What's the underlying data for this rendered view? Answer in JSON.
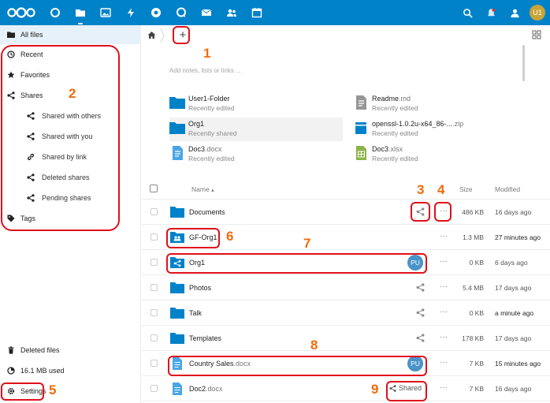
{
  "header": {
    "app_icons": [
      "dashboard-icon",
      "files-icon",
      "photos-icon",
      "activity-icon",
      "talk-icon",
      "circles-icon",
      "mail-icon",
      "contacts-icon",
      "calendar-icon"
    ],
    "avatar_initials": "U1",
    "accent_color": "#0082c9"
  },
  "sidebar": {
    "items": [
      {
        "label": "All files",
        "icon": "folder-icon"
      },
      {
        "label": "Recent",
        "icon": "clock-icon"
      },
      {
        "label": "Favorites",
        "icon": "star-icon"
      },
      {
        "label": "Shares",
        "icon": "share-icon"
      },
      {
        "label": "Shared with others",
        "icon": "share-icon"
      },
      {
        "label": "Shared with you",
        "icon": "share-icon"
      },
      {
        "label": "Shared by link",
        "icon": "link-icon"
      },
      {
        "label": "Deleted shares",
        "icon": "share-icon"
      },
      {
        "label": "Pending shares",
        "icon": "share-icon"
      },
      {
        "label": "Tags",
        "icon": "tag-icon"
      }
    ],
    "bottom": [
      {
        "label": "Deleted files",
        "icon": "trash-icon"
      },
      {
        "label": "16.1 MB used",
        "icon": "pie-icon"
      },
      {
        "label": "Settings",
        "icon": "gear-icon"
      }
    ]
  },
  "main": {
    "add_label": "+",
    "notes_placeholder": "Add notes, lists or links ...",
    "recent": [
      {
        "name": "User1-Folder",
        "ext": "",
        "status": "Recently edited",
        "icon": "folder"
      },
      {
        "name": "Readme",
        "ext": ".md",
        "status": "Recently edited",
        "icon": "text"
      },
      {
        "name": "Org1",
        "ext": "",
        "status": "Recently shared",
        "icon": "folder"
      },
      {
        "name": "openssl-1.0.2u-x64_86-...",
        "ext": ".zip",
        "status": "Recently edited",
        "icon": "archive"
      },
      {
        "name": "Doc3",
        "ext": ".docx",
        "status": "Recently edited",
        "icon": "doc"
      },
      {
        "name": "Doc3",
        "ext": ".xlsx",
        "status": "Recently edited",
        "icon": "sheet"
      }
    ],
    "columns": {
      "name": "Name",
      "sort_arrow": "▴",
      "size": "Size",
      "modified": "Modified"
    },
    "files": [
      {
        "name": "Documents",
        "ext": "",
        "icon": "folder",
        "share": "icon",
        "size": "486 KB",
        "modified": "16 days ago"
      },
      {
        "name": "GF-Org1",
        "ext": "",
        "icon": "group-folder",
        "share": "none",
        "size": "1.3 MB",
        "modified": "27 minutes ago"
      },
      {
        "name": "Org1",
        "ext": "",
        "icon": "shared-folder",
        "share": "avatar",
        "avatar": "PU",
        "size": "0 KB",
        "modified": "6 days ago"
      },
      {
        "name": "Photos",
        "ext": "",
        "icon": "folder",
        "share": "icon",
        "size": "5.4 MB",
        "modified": "17 days ago"
      },
      {
        "name": "Talk",
        "ext": "",
        "icon": "folder",
        "share": "icon",
        "size": "0 KB",
        "modified": "a minute ago"
      },
      {
        "name": "Templates",
        "ext": "",
        "icon": "folder",
        "share": "icon",
        "size": "178 KB",
        "modified": "17 days ago"
      },
      {
        "name": "Country Sales",
        "ext": ".docx",
        "icon": "doc",
        "share": "avatar",
        "avatar": "PU",
        "size": "7 KB",
        "modified": "15 minutes ago"
      },
      {
        "name": "Doc2",
        "ext": ".docx",
        "icon": "doc",
        "share": "text",
        "share_label": "Shared",
        "size": "7 KB",
        "modified": "16 days ago"
      }
    ]
  },
  "annotations": [
    "1",
    "2",
    "3",
    "4",
    "5",
    "6",
    "7",
    "8",
    "9"
  ]
}
